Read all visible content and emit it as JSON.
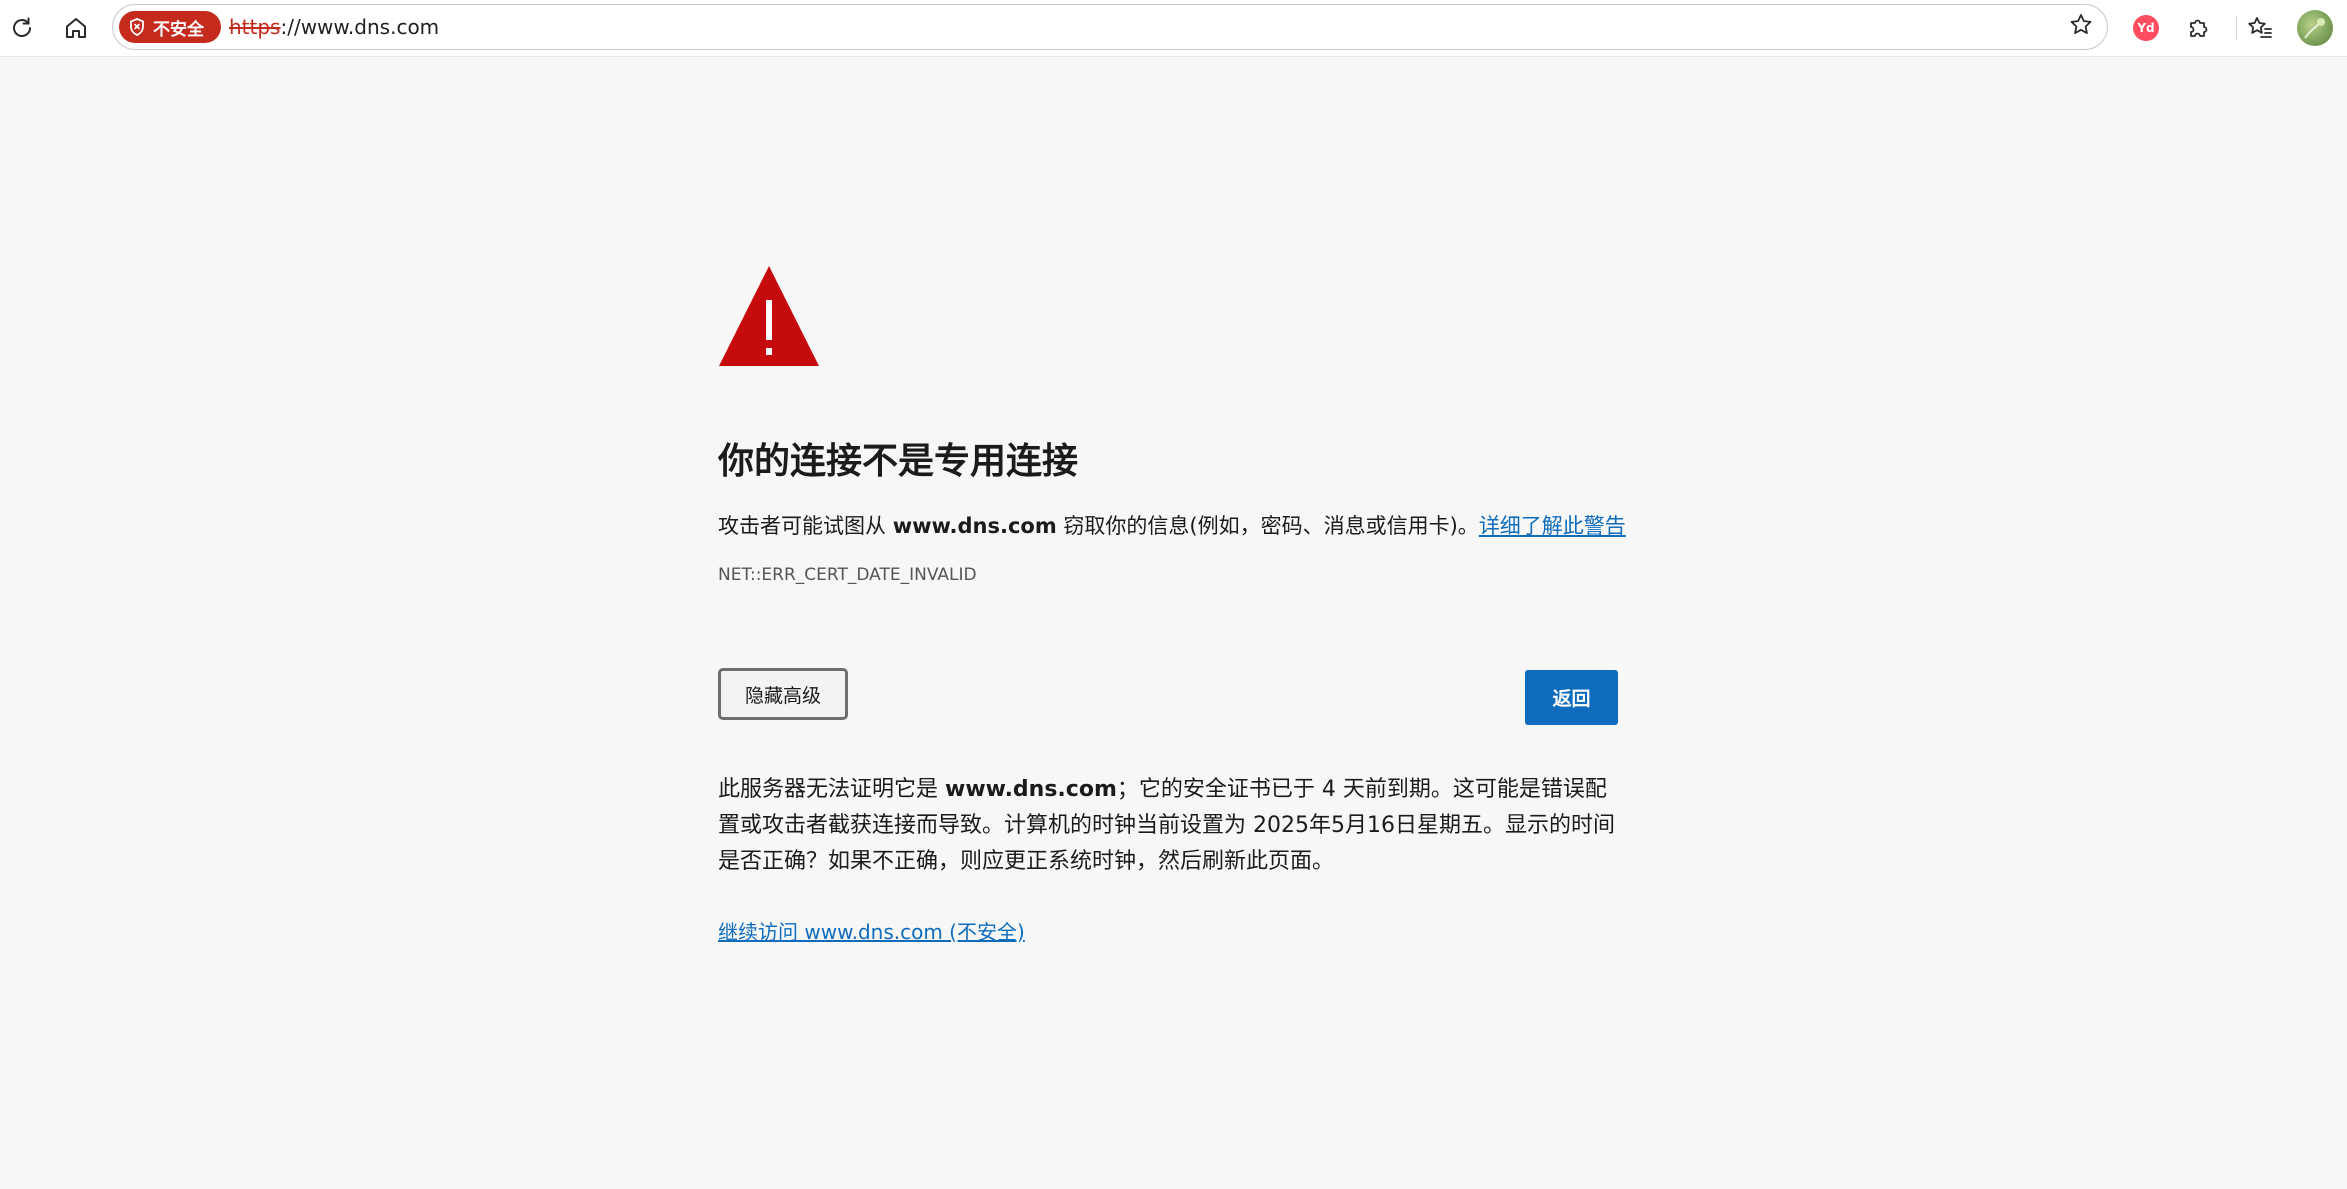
{
  "colors": {
    "danger": "#c42b1c",
    "accent": "#0f6cbd",
    "page_bg": "#f7f7f7"
  },
  "toolbar": {
    "refresh_icon": "refresh-icon",
    "home_icon": "home-icon",
    "security_chip_label": "不安全",
    "url_scheme": "https",
    "url_rest": "://www.dns.com",
    "favorite_icon": "star-outline-icon",
    "extension_yd_label": "Yd",
    "extensions_icon": "puzzle-icon",
    "favorites_icon": "favorites-list-icon",
    "profile_icon": "avatar"
  },
  "error_page": {
    "warning_icon": "warning-triangle-icon",
    "title": "你的连接不是专用连接",
    "desc_prefix": "攻击者可能试图从 ",
    "desc_host": "www.dns.com",
    "desc_suffix": " 窃取你的信息(例如，密码、消息或信用卡)。",
    "learn_more_link": "详细了解此警告",
    "error_code": "NET::ERR_CERT_DATE_INVALID",
    "hide_advanced_button": "隐藏高级",
    "back_button": "返回",
    "details_prefix": "此服务器无法证明它是 ",
    "details_host": "www.dns.com",
    "details_suffix": "；它的安全证书已于 4 天前到期。这可能是错误配置或攻击者截获连接而导致。计算机的时钟当前设置为 2025年5月16日星期五。显示的时间是否正确？如果不正确，则应更正系统时钟，然后刷新此页面。",
    "proceed_link": "继续访问 www.dns.com (不安全)"
  }
}
